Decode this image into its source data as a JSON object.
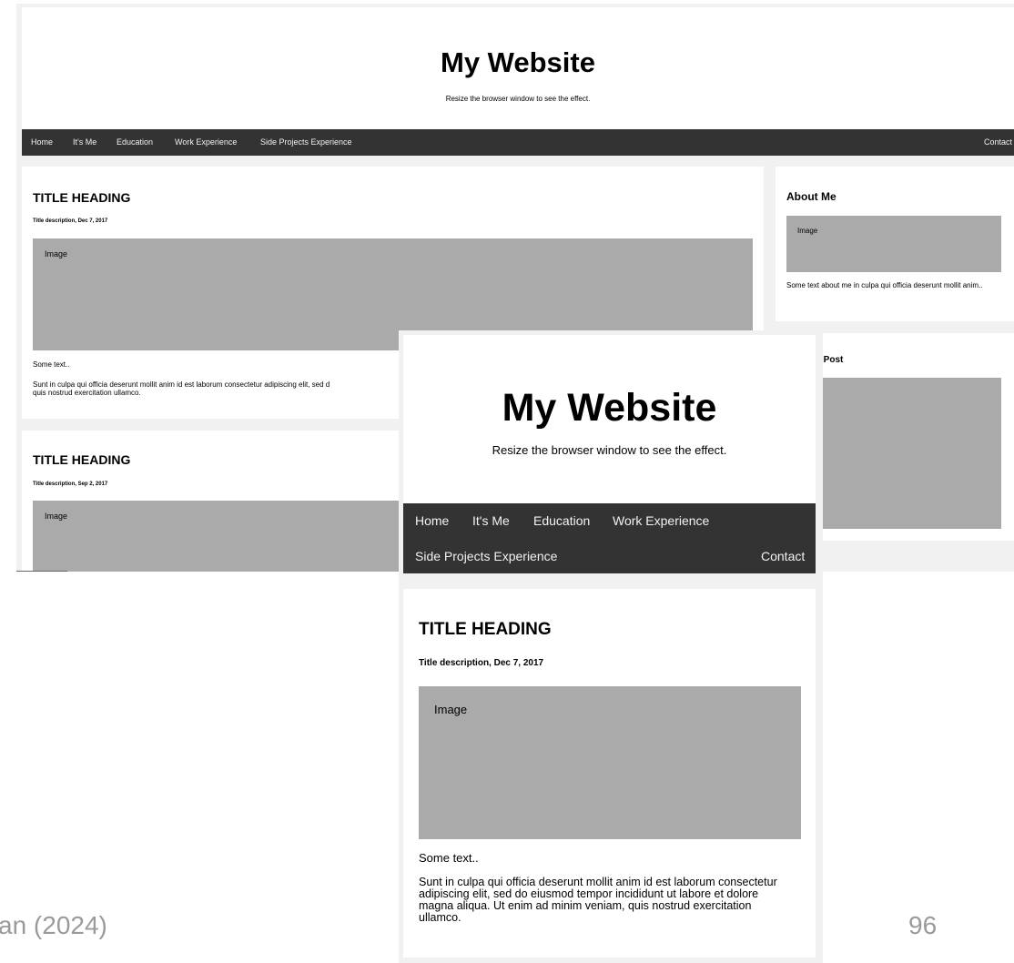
{
  "desktop": {
    "header": {
      "title": "My Website",
      "subtitle": "Resize the browser window to see the effect."
    },
    "nav": {
      "items": [
        "Home",
        "It's Me",
        "Education",
        "Work Experience",
        "Side Projects Experience"
      ],
      "right_item": "Contact"
    },
    "cards": [
      {
        "title": "TITLE HEADING",
        "description": "Title description, Dec 7, 2017",
        "image_label": "Image",
        "some_text": "Some text..",
        "body": "Sunt in culpa qui officia deserunt mollit anim id est laborum consectetur adipiscing elit, sed d",
        "body_line2": "quis nostrud exercitation ullamco."
      },
      {
        "title": "TITLE HEADING",
        "description": "Title description, Sep 2, 2017",
        "image_label": "Image"
      }
    ],
    "sidebar": {
      "about": {
        "title": "About Me",
        "image_label": "Image",
        "text": "Some text about me in culpa qui officia deserunt mollit anim.."
      },
      "popular": {
        "title_visible": "r Post"
      }
    }
  },
  "mobile": {
    "header": {
      "title": "My Website",
      "subtitle": "Resize the browser window to see the effect."
    },
    "nav": {
      "items": [
        "Home",
        "It's Me",
        "Education",
        "Work Experience"
      ],
      "second_row_item": "Side Projects Experience",
      "right_item": "Contact"
    },
    "card": {
      "title": "TITLE HEADING",
      "description": "Title description, Dec 7, 2017",
      "image_label": "Image",
      "some_text": "Some text..",
      "body": "Sunt in culpa qui officia deserunt mollit anim id est laborum consectetur adipiscing elit, sed do eiusmod tempor incididunt ut labore et dolore magna aliqua. Ut enim ad minim veniam, quis nostrud exercitation ullamco."
    }
  },
  "slide": {
    "footer_text": "an (2024)",
    "page_number": "96"
  },
  "colors": {
    "nav_bg": "#333333",
    "page_bg": "#f1f1f1",
    "image_placeholder": "#aaaaaa",
    "nav_text": "#f2f2f2"
  }
}
